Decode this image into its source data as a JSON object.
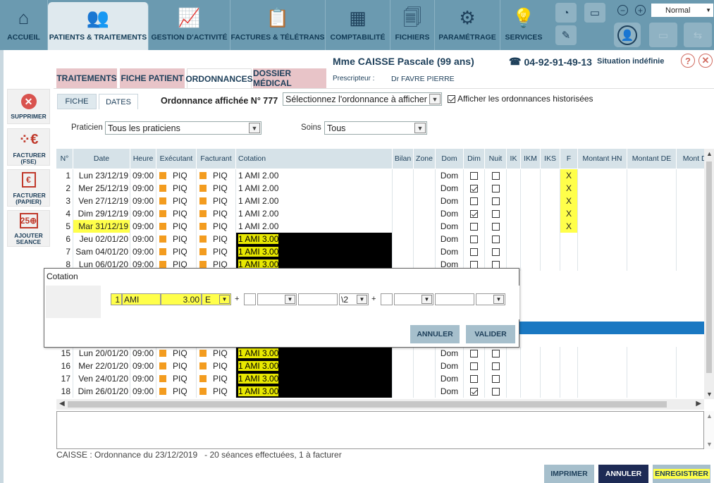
{
  "nav": {
    "tabs": [
      {
        "label": "ACCUEIL",
        "icon": "home-icon"
      },
      {
        "label": "PATIENTS & TRAITEMENTS",
        "icon": "users-icon"
      },
      {
        "label": "GESTION D'ACTIVITÉ",
        "icon": "chart-icon"
      },
      {
        "label": "FACTURES & TÉLÉTRANS",
        "icon": "invoice-icon"
      },
      {
        "label": "COMPTABILITÉ",
        "icon": "calculator-icon"
      },
      {
        "label": "FICHIERS",
        "icon": "files-icon"
      },
      {
        "label": "PARAMÉTRAGE",
        "icon": "gears-icon"
      },
      {
        "label": "SERVICES",
        "icon": "bulb-icon"
      }
    ],
    "mode": "Normal"
  },
  "patient": {
    "name": "Mme CAISSE Pascale (99 ans)",
    "phone": "04-92-91-49-13",
    "situation": "Situation indéfinie",
    "prescriber_label": "Prescripteur :",
    "prescriber": "Dr FAVRE PIERRE"
  },
  "sidebar": [
    {
      "label": "SUPPRIMER",
      "icon": "delete-icon"
    },
    {
      "label": "FACTURER (FSE)",
      "icon": "euro-circle-icon"
    },
    {
      "label": "FACTURER (PAPIER)",
      "icon": "euro-paper-icon"
    },
    {
      "label": "AJOUTER SEANCE",
      "icon": "calendar-add-icon"
    }
  ],
  "subtabs": [
    "TRAITEMENTS",
    "FICHE PATIENT",
    "ORDONNANCES",
    "DOSSIER MÉDICAL"
  ],
  "ordo": {
    "tabs": [
      "FICHE",
      "DATES"
    ],
    "title": "Ordonnance affichée N° 777",
    "select_placeholder": "Sélectionnez l'ordonnance à afficher",
    "show_history": "Afficher les ordonnances historisées",
    "praticien_label": "Praticien :",
    "praticien_value": "Tous les praticiens",
    "soins_label": "Soins :",
    "soins_value": "Tous"
  },
  "grid": {
    "headers": [
      "N°",
      "Date",
      "Heure",
      "Exécutant",
      "Facturant",
      "Cotation",
      "Bilan",
      "Zone",
      "Dom",
      "Dim",
      "Nuit",
      "IK",
      "IKM",
      "IKS",
      "F",
      "Montant HN",
      "Montant DE",
      "Mont DD"
    ],
    "rows": [
      {
        "n": "1",
        "date": "Lun 23/12/19",
        "heure": "09:00",
        "exec": "PIQ",
        "fact": "PIQ",
        "cot": "1 AMI 2.00",
        "dom": "Dom",
        "dim": false,
        "nuit": false,
        "f": "X",
        "black": false,
        "hl_date": false
      },
      {
        "n": "2",
        "date": "Mer 25/12/19",
        "heure": "09:00",
        "exec": "PIQ",
        "fact": "PIQ",
        "cot": "1 AMI 2.00",
        "dom": "Dom",
        "dim": true,
        "nuit": false,
        "f": "X",
        "black": false,
        "hl_date": false
      },
      {
        "n": "3",
        "date": "Ven 27/12/19",
        "heure": "09:00",
        "exec": "PIQ",
        "fact": "PIQ",
        "cot": "1 AMI 2.00",
        "dom": "Dom",
        "dim": false,
        "nuit": false,
        "f": "X",
        "black": false,
        "hl_date": false
      },
      {
        "n": "4",
        "date": "Dim 29/12/19",
        "heure": "09:00",
        "exec": "PIQ",
        "fact": "PIQ",
        "cot": "1 AMI 2.00",
        "dom": "Dom",
        "dim": true,
        "nuit": false,
        "f": "X",
        "black": false,
        "hl_date": false
      },
      {
        "n": "5",
        "date": "Mar 31/12/19",
        "heure": "09:00",
        "exec": "PIQ",
        "fact": "PIQ",
        "cot": "1 AMI 2.00",
        "dom": "Dom",
        "dim": false,
        "nuit": false,
        "f": "X",
        "black": false,
        "hl_date": true
      },
      {
        "n": "6",
        "date": "Jeu 02/01/20",
        "heure": "09:00",
        "exec": "PIQ",
        "fact": "PIQ",
        "cot": "1 AMI 3.00",
        "dom": "Dom",
        "dim": false,
        "nuit": false,
        "f": "",
        "black": true,
        "hl_date": false
      },
      {
        "n": "7",
        "date": "Sam 04/01/20",
        "heure": "09:00",
        "exec": "PIQ",
        "fact": "PIQ",
        "cot": "1 AMI 3.00",
        "dom": "Dom",
        "dim": false,
        "nuit": false,
        "f": "",
        "black": true,
        "hl_date": false
      },
      {
        "n": "8",
        "date": "Lun 06/01/20",
        "heure": "09:00",
        "exec": "PIQ",
        "fact": "PIQ",
        "cot": "1 AMI 3.00",
        "dom": "Dom",
        "dim": false,
        "nuit": false,
        "f": "",
        "black": true,
        "hl_date": false
      },
      {
        "n": "15",
        "date": "Lun 20/01/20",
        "heure": "09:00",
        "exec": "PIQ",
        "fact": "PIQ",
        "cot": "1 AMI 3.00",
        "dom": "Dom",
        "dim": false,
        "nuit": false,
        "f": "",
        "black": true,
        "hl_date": false
      },
      {
        "n": "16",
        "date": "Mer 22/01/20",
        "heure": "09:00",
        "exec": "PIQ",
        "fact": "PIQ",
        "cot": "1 AMI 3.00",
        "dom": "Dom",
        "dim": false,
        "nuit": false,
        "f": "",
        "black": true,
        "hl_date": false
      },
      {
        "n": "17",
        "date": "Ven 24/01/20",
        "heure": "09:00",
        "exec": "PIQ",
        "fact": "PIQ",
        "cot": "1 AMI 3.00",
        "dom": "Dom",
        "dim": false,
        "nuit": false,
        "f": "",
        "black": true,
        "hl_date": false
      },
      {
        "n": "18",
        "date": "Dim 26/01/20",
        "heure": "09:00",
        "exec": "PIQ",
        "fact": "PIQ",
        "cot": "1 AMI 3.00",
        "dom": "Dom",
        "dim": true,
        "nuit": false,
        "f": "",
        "black": true,
        "hl_date": false
      }
    ]
  },
  "dialog": {
    "title": "Cotation",
    "qty": "1",
    "code": "AMI",
    "coef": "3.00",
    "flag": "E",
    "plus1": "+",
    "div": "\\2",
    "plus2": "+",
    "cancel": "ANNULER",
    "validate": "VALIDER"
  },
  "status": "CAISSE : Ordonnance du 23/12/2019   - 20 séances effectuées, 1 à facturer",
  "footer": {
    "print": "IMPRIMER",
    "cancel": "ANNULER",
    "save": "ENREGISTRER"
  }
}
